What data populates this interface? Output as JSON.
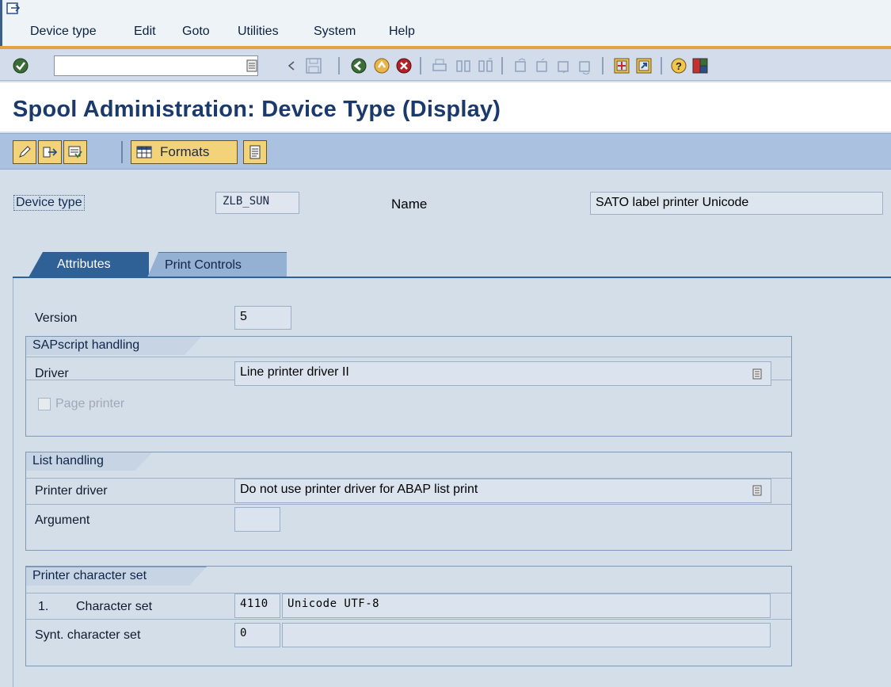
{
  "menubar": {
    "items": [
      "Device type",
      "Edit",
      "Goto",
      "Utilities",
      "System",
      "Help"
    ]
  },
  "toolbar": {
    "command_field_value": "",
    "icons": [
      "enter-icon",
      "back-icon",
      "exit-icon",
      "cancel-icon",
      "print-icon",
      "find-icon",
      "find-next-icon",
      "first-page-icon",
      "prev-page-icon",
      "next-page-icon",
      "last-page-icon",
      "create-session-icon",
      "shortcut-icon",
      "help-icon",
      "layout-icon"
    ]
  },
  "title": "Spool Administration: Device Type (Display)",
  "app_toolbar": {
    "formats_label": "Formats"
  },
  "header": {
    "device_type_label": "Device type",
    "device_type_value": "ZLB_SUN",
    "name_label": "Name",
    "name_value": "SATO label printer Unicode"
  },
  "tabs": {
    "attributes": "Attributes",
    "print_controls": "Print Controls"
  },
  "attributes": {
    "version_label": "Version",
    "version_value": "5",
    "sapscript": {
      "title": "SAPscript handling",
      "driver_label": "Driver",
      "driver_value": "Line printer driver II",
      "page_printer_label": "Page printer"
    },
    "list_handling": {
      "title": "List handling",
      "printer_driver_label": "Printer driver",
      "printer_driver_value": "Do not use printer driver for ABAP list print",
      "argument_label": "Argument",
      "argument_value": ""
    },
    "charset": {
      "title": "Printer character set",
      "char_set_number": "1.",
      "char_set_label": "Character set",
      "char_set_code": "4110",
      "char_set_desc": "Unicode UTF-8",
      "synt_label": "Synt. character set",
      "synt_code": "0",
      "synt_desc": ""
    }
  },
  "colors": {
    "title": "#1b3a6b",
    "app_toolbar": "#aac2df",
    "tab_active": "#2f6196",
    "button": "#f3d37a"
  }
}
